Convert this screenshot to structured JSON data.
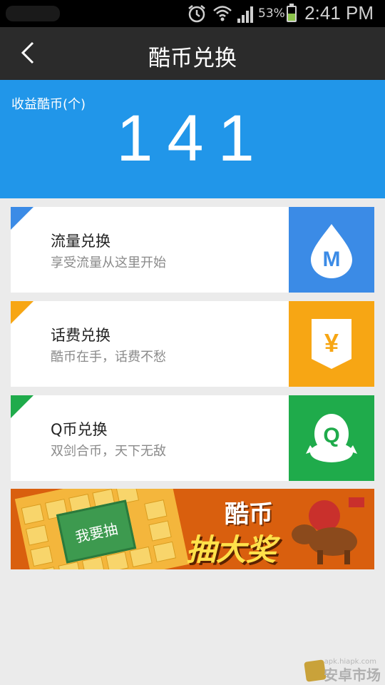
{
  "status_bar": {
    "battery_percent": "53%",
    "time": "2:41 PM"
  },
  "header": {
    "title": "酷币兑换"
  },
  "earnings": {
    "label": "收益酷币(个)",
    "value": "141"
  },
  "exchanges": [
    {
      "title": "流量兑换",
      "subtitle": "享受流量从这里开始",
      "color": "#3b8be6",
      "icon": "data-drop-icon",
      "icon_text": "M"
    },
    {
      "title": "话费兑换",
      "subtitle": "酷币在手，话费不愁",
      "color": "#f7a614",
      "icon": "yuan-icon",
      "icon_text": "¥"
    },
    {
      "title": "Q币兑换",
      "subtitle": "双剑合币，天下无敌",
      "color": "#1fab4b",
      "icon": "qq-penguin-icon",
      "icon_text": "Q"
    }
  ],
  "banner": {
    "button_text": "我要抽",
    "title": "酷币",
    "subtitle": "抽大奖"
  },
  "watermark": {
    "url": "apk.hiapk.com",
    "text": "安卓市场"
  }
}
